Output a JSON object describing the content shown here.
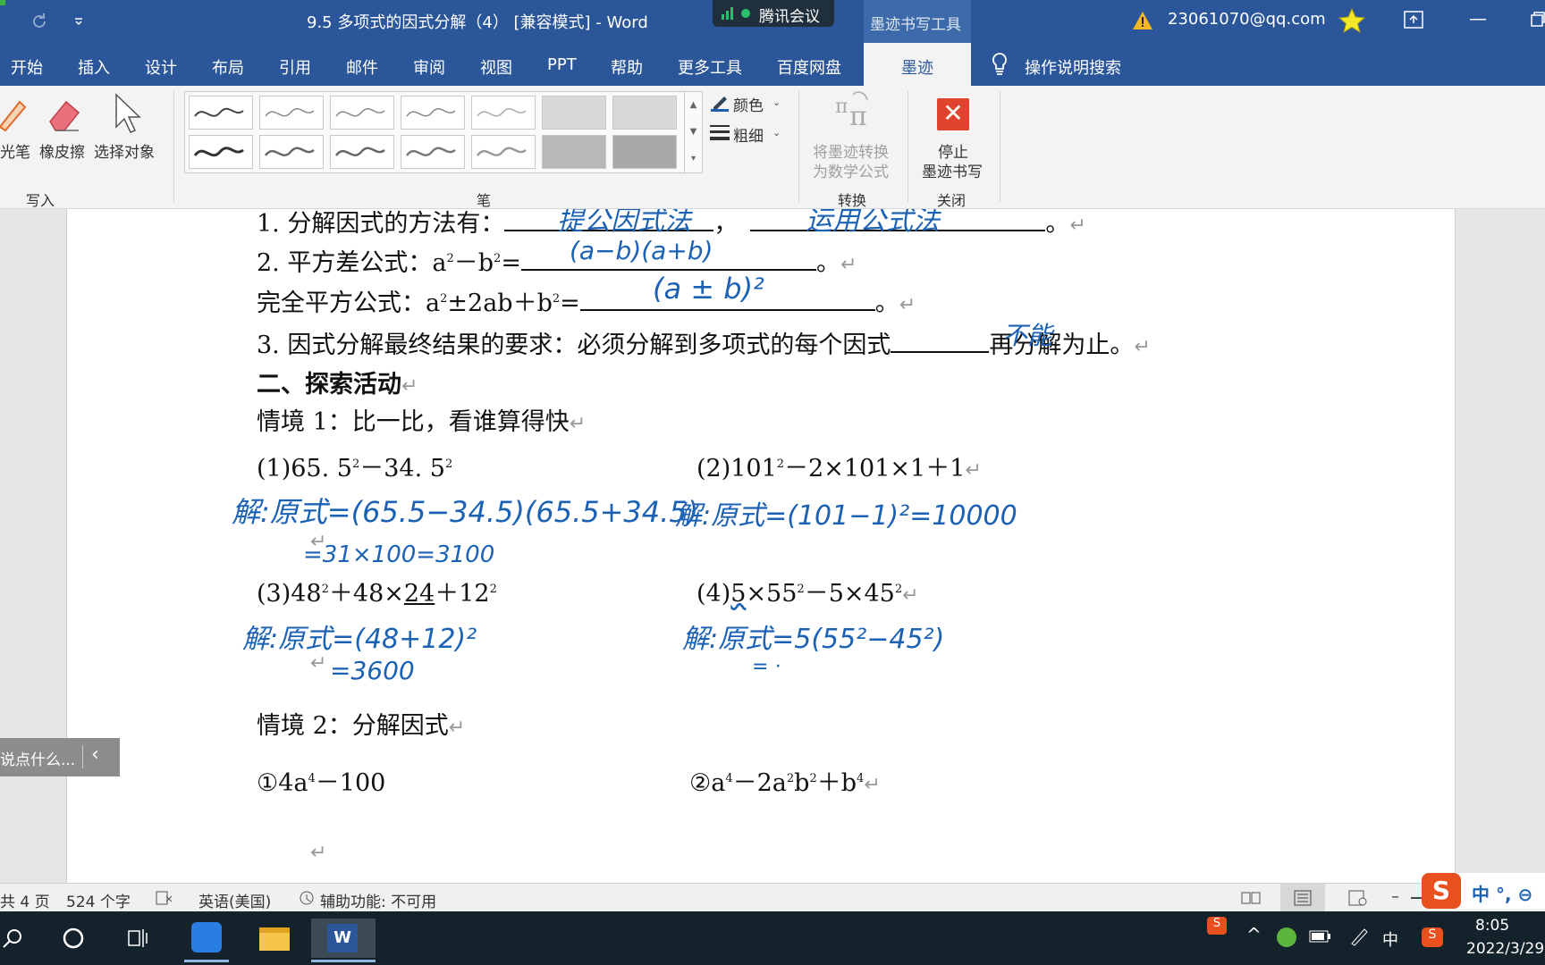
{
  "window": {
    "title": "9.5 多项式的因式分解（4） [兼容模式] - Word",
    "meeting": "腾讯会议",
    "context_tool": "墨迹书写工具",
    "account": "23061070@qq.com"
  },
  "tabs": [
    "开始",
    "插入",
    "设计",
    "布局",
    "引用",
    "邮件",
    "审阅",
    "视图",
    "PPT",
    "帮助",
    "更多工具",
    "百度网盘",
    "墨迹"
  ],
  "search": "操作说明搜索",
  "ribbon": {
    "highlighter": "光笔",
    "eraser": "橡皮擦",
    "select": "选择对象",
    "group_write": "写入",
    "group_pens": "笔",
    "color": "颜色",
    "thickness": "粗细",
    "convert_l1": "将墨迹转换",
    "convert_l2": "为数学公式",
    "group_convert": "转换",
    "stop_l1": "停止",
    "stop_l2": "墨迹书写",
    "group_close": "关闭"
  },
  "doc": {
    "l1a": "1. 分解因式的方法有：",
    "l1b": "，",
    "l1c": "。",
    "l2a": "2. 平方差公式：a",
    "l2b": "－b",
    "l2c": "=",
    "l2d": "。",
    "l3a": "完全平方公式：a",
    "l3b": "±2ab＋b",
    "l3c": "=",
    "l3d": "。",
    "l4a": "3. 因式分解最终结果的要求：必须分解到多项式的每个因式",
    "l4b": "再分解为止。",
    "h2": "二、探索活动",
    "s1": "情境 1：比一比，看谁算得快",
    "p1a": "(1)65. 5",
    "p1b": "－34. 5",
    "p2a": "(2)101",
    "p2b": "－2×101×1＋1",
    "p3a": "(3)48",
    "p3b": "＋48×",
    "p3c": "24",
    "p3d": "＋12",
    "p4a": "(4)",
    "p4b": "5",
    "p4c": "×55",
    "p4d": "－5×45",
    "sq": "2",
    "s2": "情境 2：分解因式",
    "q1a": "①4a",
    "q1b": "－100",
    "q2a": "②a",
    "q2b": "－2a",
    "q2c": "b",
    "q2d": "＋b",
    "p4": "4",
    "ret": "↵"
  },
  "ink": {
    "m1": "提公因式法",
    "m2": "运用公式法",
    "diff": "(a−b)(a+b)",
    "sqf": "(a ± b)²",
    "cant": "不能",
    "a1": "解:原式=(65.5−34.5)(65.5+34.5)",
    "a1b": "=31×100=3100",
    "a2": "解:原式=(101−1)²=10000",
    "a3": "解:原式=(48+12)²",
    "a3b": "=3600",
    "a4": "解:原式=5(55²−45²)",
    "a4b": "= ·"
  },
  "comment": "说点什么...",
  "status": {
    "pages": "共 4 页",
    "words": "524 个字",
    "lang": "英语(美国)",
    "access": "辅助功能: 不可用"
  },
  "tray": {
    "ime": "中",
    "ime2": "中 °, ⊖",
    "time": "8:05",
    "date": "2022/3/29"
  }
}
